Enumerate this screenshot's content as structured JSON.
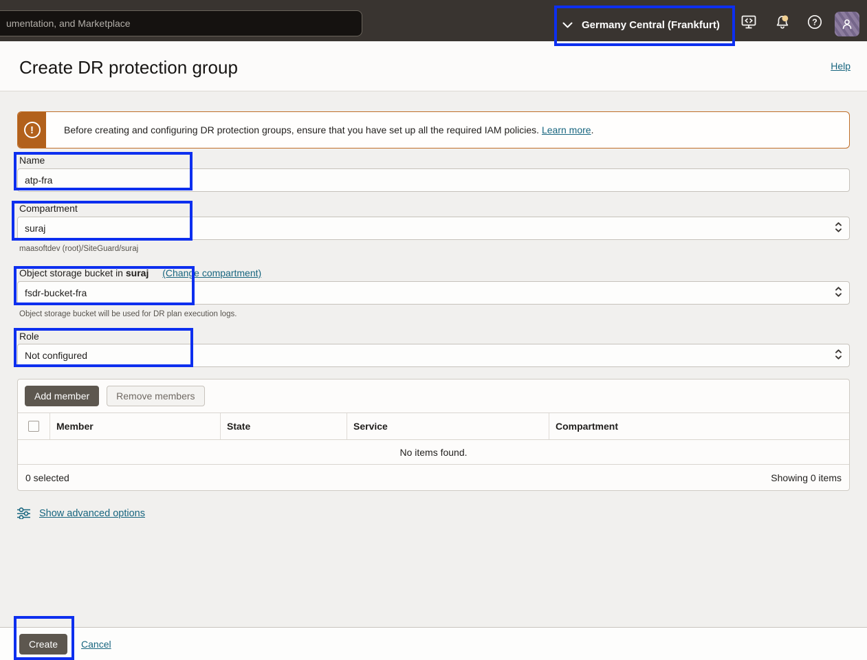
{
  "topbar": {
    "search_value": "umentation, and Marketplace",
    "region_label": "Germany Central (Frankfurt)",
    "icons": {
      "region_chevron": "chevron-down",
      "cloud_shell": "monitor-with-code",
      "notifications": "bell-with-badge",
      "help": "question-circle",
      "avatar": "user-silhouette"
    }
  },
  "header": {
    "title": "Create DR protection group",
    "help_label": "Help"
  },
  "banner": {
    "icon": "exclamation-circle",
    "text": "Before creating and configuring DR protection groups, ensure that you have set up all the required IAM policies.",
    "link_label": "Learn more",
    "suffix": "."
  },
  "form": {
    "name": {
      "label": "Name",
      "value": "atp-fra"
    },
    "compartment": {
      "label": "Compartment",
      "value": "suraj",
      "helper": "maasoftdev (root)/SiteGuard/suraj"
    },
    "bucket": {
      "label_prefix": "Object storage bucket in",
      "label_bold": "suraj",
      "change_link": "(Change compartment)",
      "value": "fsdr-bucket-fra",
      "helper": "Object storage bucket will be used for DR plan execution logs."
    },
    "role": {
      "label": "Role",
      "value": "Not configured"
    }
  },
  "members": {
    "add_label": "Add member",
    "remove_label": "Remove members",
    "columns": [
      "Member",
      "State",
      "Service",
      "Compartment"
    ],
    "empty_text": "No items found.",
    "selected_text": "0 selected",
    "showing_text": "Showing 0 items"
  },
  "advanced": {
    "icon": "sliders",
    "label": "Show advanced options"
  },
  "footer": {
    "create_label": "Create",
    "cancel_label": "Cancel"
  },
  "colors": {
    "annotation_blue": "#0d2fef",
    "topbar_bg": "#393430",
    "warning_orange": "#b2611c",
    "link_teal": "#17657f",
    "primary_button_bg": "#5d574f",
    "avatar_purple": "#8d7d9f",
    "notification_badge": "#f0cf92",
    "page_bg": "#f1f0ee"
  }
}
